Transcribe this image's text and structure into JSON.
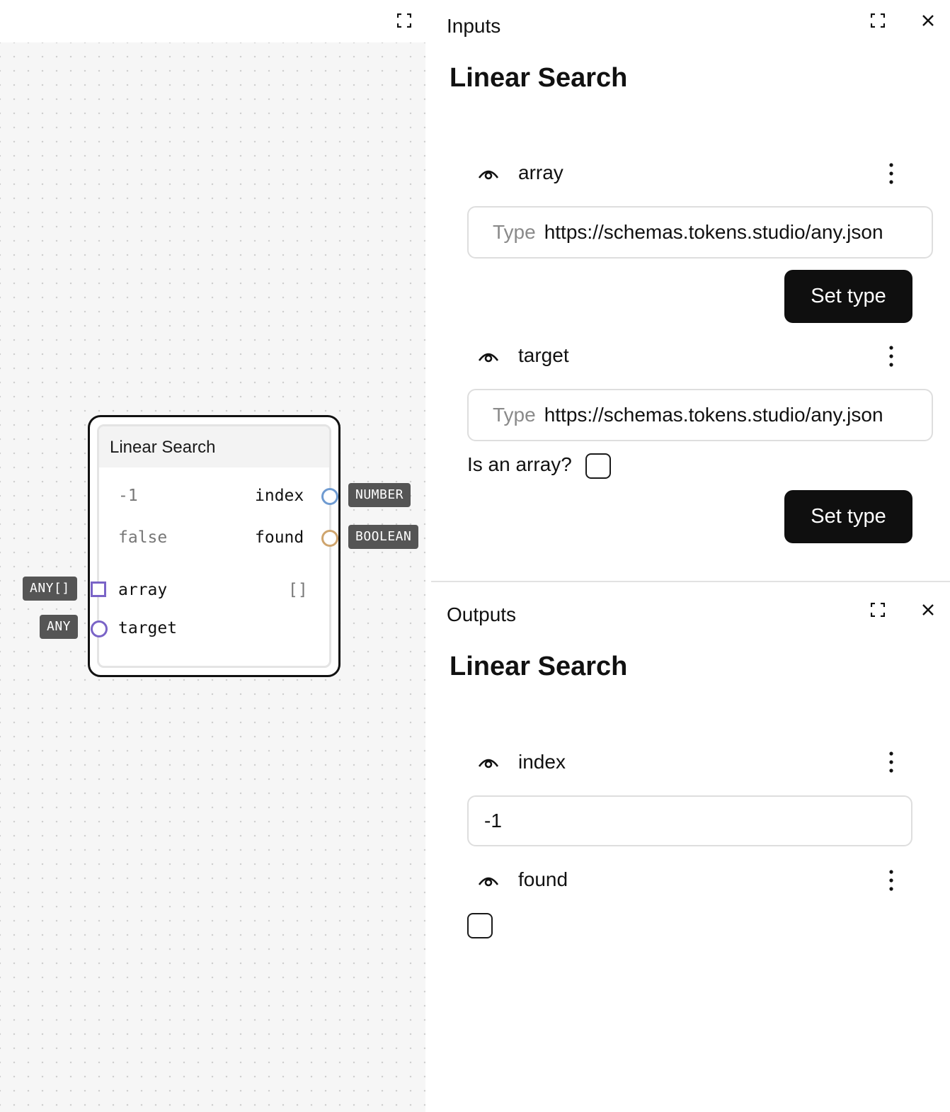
{
  "canvas": {
    "node": {
      "title": "Linear Search",
      "outputs": [
        {
          "value": "-1",
          "name": "index",
          "type": "NUMBER",
          "port_color": "#6f9bd1"
        },
        {
          "value": "false",
          "name": "found",
          "type": "BOOLEAN",
          "port_color": "#cfa56e"
        }
      ],
      "inputs": [
        {
          "name": "array",
          "value": "[]",
          "type": "ANY[]",
          "port_color": "#7a64c7"
        },
        {
          "name": "target",
          "type": "ANY",
          "port_color": "#7a64c7"
        }
      ]
    }
  },
  "inputs_panel": {
    "header": "Inputs",
    "title": "Linear Search",
    "items": [
      {
        "name": "array",
        "type_label": "Type",
        "type_value": "https://schemas.tokens.studio/any.json",
        "button": "Set type"
      },
      {
        "name": "target",
        "type_label": "Type",
        "type_value": "https://schemas.tokens.studio/any.json",
        "is_array_label": "Is an array?",
        "button": "Set type"
      }
    ]
  },
  "outputs_panel": {
    "header": "Outputs",
    "title": "Linear Search",
    "items": [
      {
        "name": "index",
        "value": "-1"
      },
      {
        "name": "found"
      }
    ]
  },
  "icons": {
    "expand": "expand-icon",
    "close": "close-icon",
    "eye": "eye-icon",
    "more": "kebab-icon"
  }
}
